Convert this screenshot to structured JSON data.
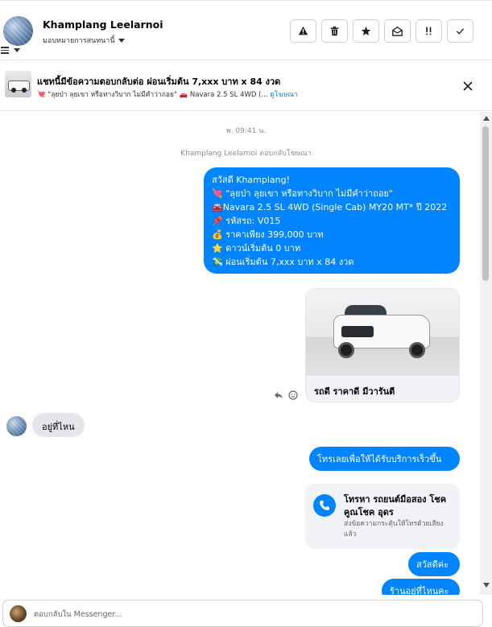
{
  "header": {
    "contact_name": "Khamplang Leelarnoi",
    "assign_label": "มอบหมายการสนทนานี้",
    "actions": [
      "alert-icon",
      "trash-icon",
      "star-icon",
      "envelope-open-icon",
      "double-exclaim-icon",
      "check-icon"
    ]
  },
  "ad_banner": {
    "title": "แชทนี้มีข้อความตอบกลับต่อ ผ่อนเริ่มต้น 7,xxx บาท x 84 งวด",
    "subtitle": "💘 \"ลุยป่า ลุยเขา หรือทางวิบาก ไม่มีคำว่าถอย\" 🚗 Navara 2.5 SL 4WD (...",
    "link_text": "ดูโฆษณา"
  },
  "chat": {
    "timestamp": "พ. 09:41 น.",
    "reply_note": "Khamplang Leelarnoi ตอบกลับโฆษณา",
    "ad_message_lines": [
      "สวัสดี Khamplang!",
      "💘 \"ลุยป่า ลุยเขา หรือทางวิบาก ไม่มีคำว่าถอย\"",
      "🚘Navara 2.5 SL 4WD (Single Cab) MY20 MT* ปี 2022",
      "📌 รหัสรถ: V015",
      "💰 ราคาเพียง 399,000 บาท",
      "⭐ ดาวน์เริ่มต้น 0 บาท",
      "💸 ผ่อนเริ่มต้น 7,xxx บาท x 84 งวด"
    ],
    "card_caption": "รถดี ราคาดี มีวารันตี",
    "incoming_message": "อยู่ที่ไหน",
    "outgoing_call_prompt": "โทรเลยเพื่อให้ได้รับบริการเร็วขึ้น",
    "call_card": {
      "title": "โทรหา รถยนต์มือสอง โชคคูณโชค อุดร",
      "subtitle": "ส่งข้อความกระตุ้นให้โทรด้วยเสียงแล้ว"
    },
    "greeting_reply": "สวัสดีค่ะ",
    "partial_reply": "ร้านอยู่ที่ไหนคะ"
  },
  "composer": {
    "placeholder": "ตอบกลับใน Messenger..."
  }
}
